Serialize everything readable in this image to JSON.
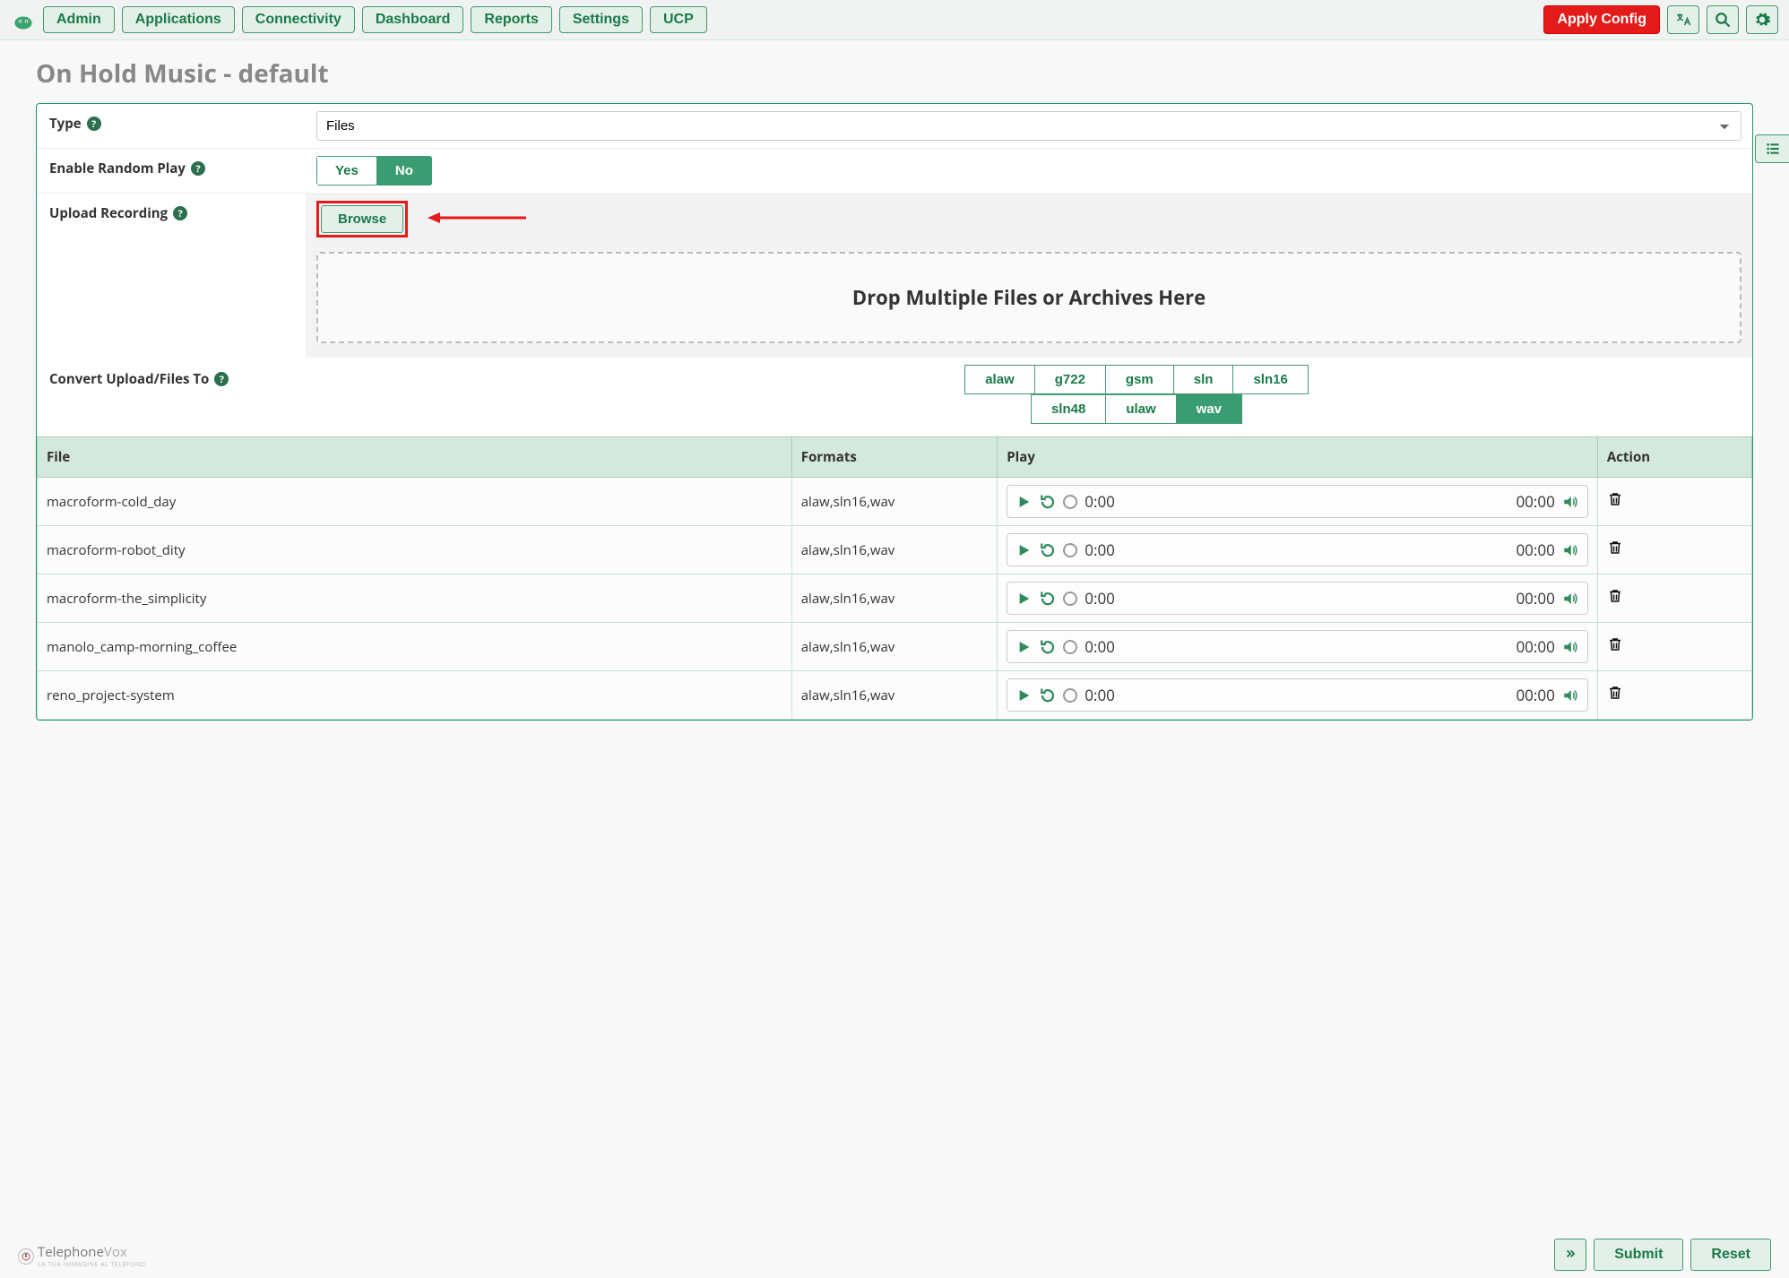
{
  "nav": {
    "items": [
      "Admin",
      "Applications",
      "Connectivity",
      "Dashboard",
      "Reports",
      "Settings",
      "UCP"
    ],
    "apply": "Apply Config"
  },
  "page": {
    "title": "On Hold Music - default"
  },
  "form": {
    "type_label": "Type",
    "type_value": "Files",
    "random_label": "Enable Random Play",
    "random_yes": "Yes",
    "random_no": "No",
    "upload_label": "Upload Recording",
    "browse": "Browse",
    "dropzone": "Drop Multiple Files or Archives Here",
    "convert_label": "Convert Upload/Files To",
    "codecs_row1": [
      "alaw",
      "g722",
      "gsm",
      "sln",
      "sln16"
    ],
    "codecs_row2": [
      "sln48",
      "ulaw",
      "wav"
    ],
    "codec_active": "wav"
  },
  "table": {
    "headers": {
      "file": "File",
      "formats": "Formats",
      "play": "Play",
      "action": "Action"
    },
    "rows": [
      {
        "file": "macroform-cold_day",
        "formats": "alaw,sln16,wav",
        "cur": "0:00",
        "dur": "00:00"
      },
      {
        "file": "macroform-robot_dity",
        "formats": "alaw,sln16,wav",
        "cur": "0:00",
        "dur": "00:00"
      },
      {
        "file": "macroform-the_simplicity",
        "formats": "alaw,sln16,wav",
        "cur": "0:00",
        "dur": "00:00"
      },
      {
        "file": "manolo_camp-morning_coffee",
        "formats": "alaw,sln16,wav",
        "cur": "0:00",
        "dur": "00:00"
      },
      {
        "file": "reno_project-system",
        "formats": "alaw,sln16,wav",
        "cur": "0:00",
        "dur": "00:00"
      }
    ]
  },
  "footer": {
    "submit": "Submit",
    "reset": "Reset"
  },
  "watermark": {
    "brand": "Telephone",
    "brand2": "Vox",
    "tagline": "LA TUA IMMAGINE AL TELEFONO"
  }
}
